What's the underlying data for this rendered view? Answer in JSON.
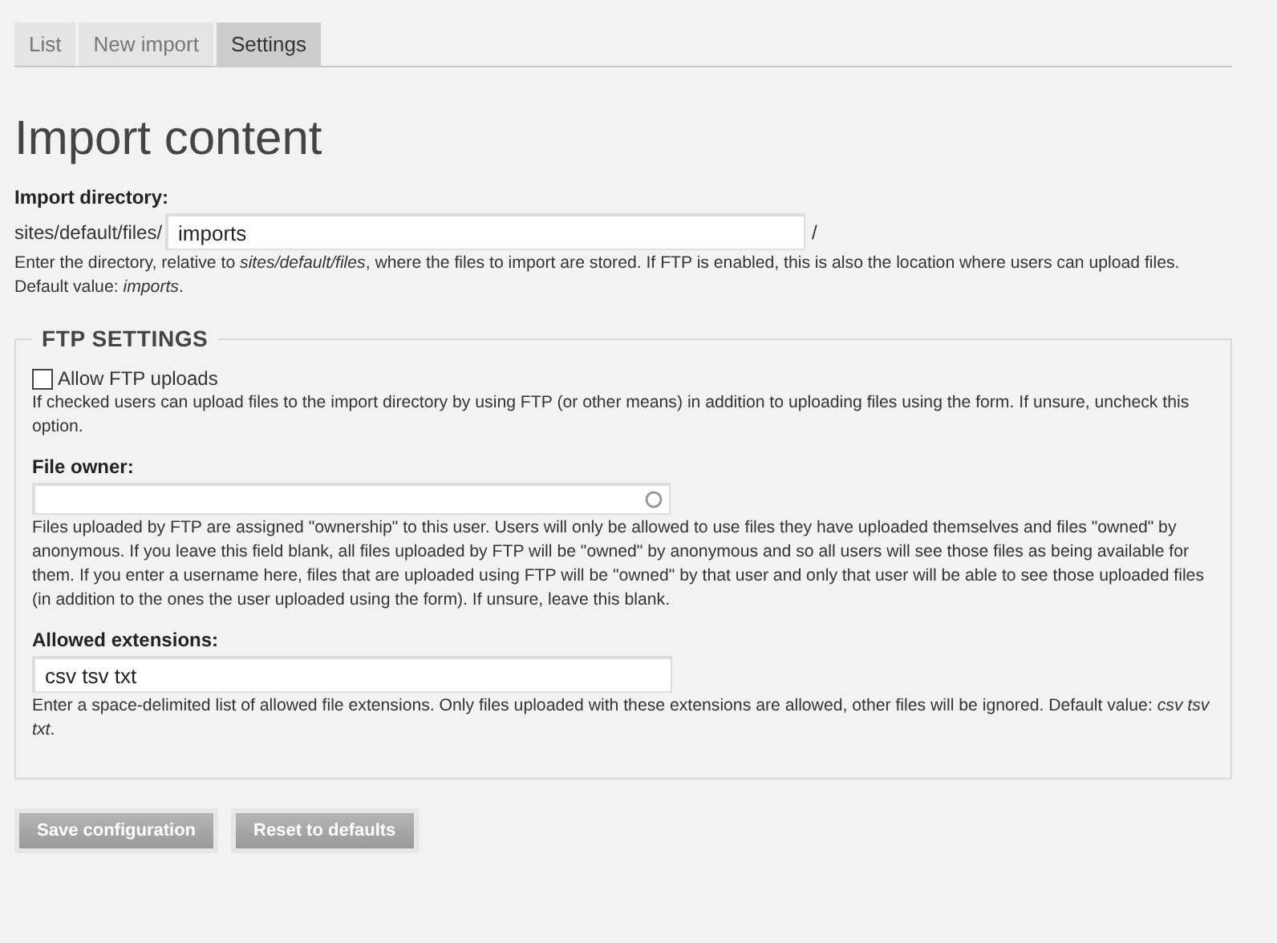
{
  "tabs": [
    {
      "label": "List",
      "selected": false
    },
    {
      "label": "New import",
      "selected": false
    },
    {
      "label": "Settings",
      "selected": true
    }
  ],
  "title": "Import content",
  "import_directory": {
    "label": "Import directory:",
    "prefix": "sites/default/files/",
    "value": "imports",
    "suffix": "/",
    "description": "Enter the directory, relative to *sites/default/files*, where the files to import are stored. If FTP is enabled, this is also the location where users can upload files. Default value: *imports*."
  },
  "ftp_settings": {
    "legend": "FTP SETTINGS",
    "allow_ftp": {
      "label": "Allow FTP uploads",
      "checked": false,
      "description": "If checked users can upload files to the import directory by using FTP (or other means) in addition to uploading files using the form. If unsure, uncheck this option."
    },
    "file_owner": {
      "label": "File owner:",
      "description": "Files uploaded by FTP are assigned \"ownership\" to this user. Users will only be allowed to use files they have uploaded themselves and files \"owned\" by anonymous. If you leave this field blank, all files uploaded by FTP will be \"owned\" by anonymous and so all users will see those files as being available for them. If you enter a username here, files that are uploaded using FTP will be \"owned\" by that user and only that user will be able to see those uploaded files (in addition to the ones the user uploaded using the form). If unsure, leave this blank."
    },
    "allowed_extensions": {
      "label": "Allowed extensions:",
      "value": "csv tsv txt",
      "description": "Enter a space-delimited list of allowed file extensions. Only files uploaded with these extensions are allowed, other files will be ignored. Default value: *csv tsv txt*."
    }
  },
  "buttons": [
    "Save configuration",
    "Reset to defaults"
  ]
}
